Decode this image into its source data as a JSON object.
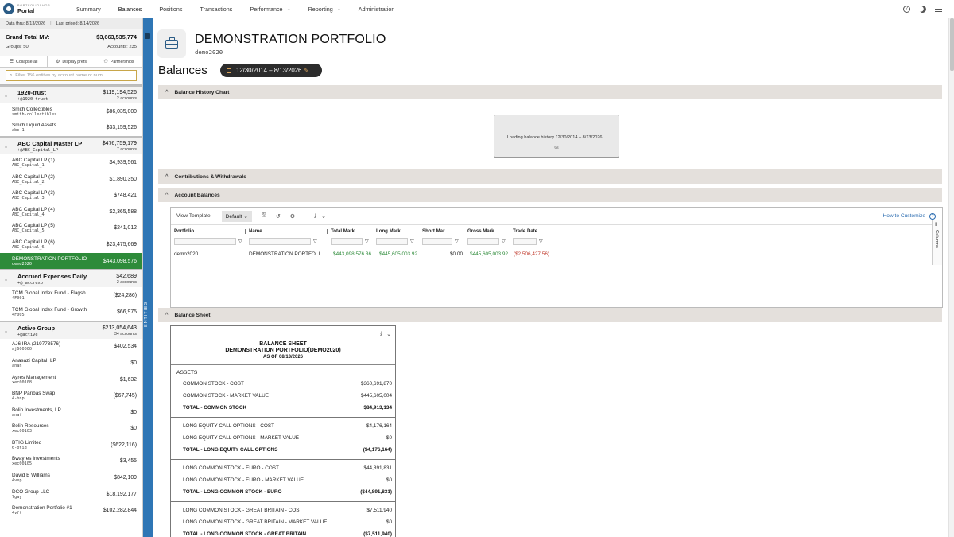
{
  "app": {
    "logo_small": "PORTFOLIOSHOP",
    "logo_big": "Portal"
  },
  "nav": {
    "items": [
      {
        "label": "Summary"
      },
      {
        "label": "Balances",
        "active": true
      },
      {
        "label": "Positions"
      },
      {
        "label": "Transactions"
      },
      {
        "label": "Performance",
        "dropdown": true
      },
      {
        "label": "Reporting",
        "dropdown": true
      },
      {
        "label": "Administration"
      }
    ],
    "right_icons": [
      "help-icon",
      "moon-icon",
      "menu-icon"
    ]
  },
  "sidebar": {
    "data_thru": "Data thru: 8/13/2026",
    "last_priced": "Last priced: 8/14/2026",
    "grand_total_label": "Grand Total MV:",
    "grand_total_value": "$3,663,535,774",
    "groups": "Groups: 50",
    "accounts": "Accounts: 235",
    "toolbar": {
      "collapse": "Collapse all",
      "display": "Display prefs",
      "partnerships": "Partnerships"
    },
    "filter_placeholder": "Filter 156 entities by account name or num...",
    "entities_label": "Entities",
    "group_list": [
      {
        "name": "1920-trust",
        "code": "+@1920-trust",
        "value": "$119,194,526",
        "accounts": "2 accounts",
        "items": [
          {
            "name": "Smith Collectibles",
            "code": "smith-collectibles",
            "value": "$86,035,000"
          },
          {
            "name": "Smith Liquid Assets",
            "code": "abc-1",
            "value": "$33,159,526"
          }
        ]
      },
      {
        "name": "ABC Capital Master LP",
        "code": "+@ABC_Capital_LP",
        "value": "$476,759,179",
        "accounts": "7 accounts",
        "items": [
          {
            "name": "ABC Capital LP (1)",
            "code": "ABC_Capital_1",
            "value": "$4,939,561"
          },
          {
            "name": "ABC Capital LP (2)",
            "code": "ABC_Capital_2",
            "value": "$1,890,350"
          },
          {
            "name": "ABC Capital LP (3)",
            "code": "ABC_Capital_3",
            "value": "$748,421"
          },
          {
            "name": "ABC Capital LP (4)",
            "code": "ABC_Capital_4",
            "value": "$2,365,588"
          },
          {
            "name": "ABC Capital LP (5)",
            "code": "ABC_Capital_5",
            "value": "$241,012"
          },
          {
            "name": "ABC Capital LP (6)",
            "code": "ABC_Capital_6",
            "value": "$23,475,669"
          },
          {
            "name": "DEMONSTRATION PORTFOLIO",
            "code": "demo2020",
            "value": "$443,098,576",
            "selected": true
          }
        ]
      },
      {
        "name": "Accrued Expenses Daily",
        "code": "+@_accrexp",
        "value": "$42,689",
        "accounts": "2 accounts",
        "items": [
          {
            "name": "TCM Global Index Fund - Flagsh...",
            "code": "4F001",
            "value": "($24,286)"
          },
          {
            "name": "TCM Global Index Fund - Growth",
            "code": "4F005",
            "value": "$66,975"
          }
        ]
      },
      {
        "name": "Active Group",
        "code": "+@active",
        "value": "$213,054,643",
        "accounts": "34 accounts",
        "items": [
          {
            "name": "AJ6 IRA (219773576)",
            "code": "aj600000",
            "value": "$402,534"
          },
          {
            "name": "Anasazi Capital, LP",
            "code": "anah",
            "value": "$0"
          },
          {
            "name": "Ayres Management",
            "code": "xec00108",
            "value": "$1,632"
          },
          {
            "name": "BNP Paribas Swap",
            "code": "4-bnp",
            "value": "($67,745)"
          },
          {
            "name": "Bolin Investments, LP",
            "code": "anaf",
            "value": "$0"
          },
          {
            "name": "Bolin Resources",
            "code": "xec00103",
            "value": "$0"
          },
          {
            "name": "BTIG Limited",
            "code": "6-btig",
            "value": "($622,116)"
          },
          {
            "name": "Bwayres Investments",
            "code": "xec00105",
            "value": "$3,455"
          },
          {
            "name": "David B Williams",
            "code": "4vep",
            "value": "$842,109"
          },
          {
            "name": "DCO Group LLC",
            "code": "7gwy",
            "value": "$18,192,177"
          },
          {
            "name": "Demonstration Portfolio #1",
            "code": "4vft",
            "value": "$102,282,844"
          }
        ]
      }
    ]
  },
  "header": {
    "portfolio_title": "DEMONSTRATION PORTFOLIO",
    "portfolio_code": "demo2020",
    "page_title": "Balances",
    "date_range": "12/30/2014 – 8/13/2026"
  },
  "sections": {
    "history_chart": "Balance History Chart",
    "contributions": "Contributions & Withdrawals",
    "account_balances": "Account Balances",
    "balance_sheet": "Balance Sheet"
  },
  "loading": {
    "text": "Loading balance history 12/30/2014 – 8/13/2026...",
    "time": "6s"
  },
  "grid": {
    "view_template_label": "View Template",
    "template_value": "Default",
    "how_to": "How to Customize",
    "columns_label": "Columns",
    "columns": [
      {
        "label": "Portfolio"
      },
      {
        "label": "Name"
      },
      {
        "label": "Total Mark..."
      },
      {
        "label": "Long Mark..."
      },
      {
        "label": "Short Mar..."
      },
      {
        "label": "Gross Mark..."
      },
      {
        "label": "Trade Date..."
      }
    ],
    "rows": [
      {
        "portfolio": "demo2020",
        "name": "DEMONSTRATION PORTFOLI",
        "total": "$443,098,576.36",
        "long": "$445,605,003.92",
        "short": "$0.00",
        "gross": "$445,605,003.92",
        "trade": "($2,506,427.56)"
      }
    ]
  },
  "balance_sheet": {
    "title": "BALANCE SHEET",
    "subtitle": "DEMONSTRATION PORTFOLIO(DEMO2020)",
    "as_of": "AS OF 08/13/2026",
    "assets_label": "ASSETS",
    "blocks": [
      [
        {
          "label": "COMMON STOCK - COST",
          "value": "$360,691,870"
        },
        {
          "label": "COMMON STOCK - MARKET VALUE",
          "value": "$445,605,004"
        },
        {
          "label": "TOTAL - COMMON STOCK",
          "value": "$84,913,134",
          "total": true
        }
      ],
      [
        {
          "label": "LONG EQUITY CALL OPTIONS - COST",
          "value": "$4,176,164"
        },
        {
          "label": "LONG EQUITY CALL OPTIONS - MARKET VALUE",
          "value": "$0"
        },
        {
          "label": "TOTAL - LONG EQUITY CALL OPTIONS",
          "value": "($4,176,164)",
          "total": true
        }
      ],
      [
        {
          "label": "LONG COMMON STOCK - EURO - COST",
          "value": "$44,891,831"
        },
        {
          "label": "LONG COMMON STOCK - EURO - MARKET VALUE",
          "value": "$0"
        },
        {
          "label": "TOTAL - LONG COMMON STOCK - EURO",
          "value": "($44,891,831)",
          "total": true
        }
      ],
      [
        {
          "label": "LONG COMMON STOCK - GREAT BRITAIN - COST",
          "value": "$7,511,940"
        },
        {
          "label": "LONG COMMON STOCK - GREAT BRITAIN - MARKET VALUE",
          "value": "$0"
        },
        {
          "label": "TOTAL - LONG COMMON STOCK - GREAT BRITAIN",
          "value": "($7,511,940)",
          "total": true
        }
      ]
    ]
  }
}
